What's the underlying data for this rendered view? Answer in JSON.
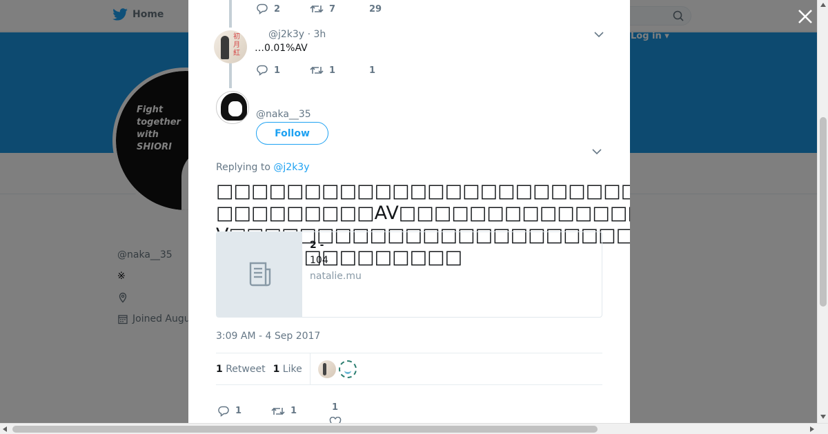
{
  "nav": {
    "home_label": "Home",
    "login_label": "Log in ▾"
  },
  "profile": {
    "avatar_text": "Fight together with SHIORI",
    "handle": "@naka__35",
    "bio_symbol": "※",
    "joined": "Joined Augu"
  },
  "thread": {
    "prev_tweet_actions": {
      "replies": "2",
      "retweets": "7",
      "likes": "29"
    },
    "parent": {
      "handle": "@j2k3y",
      "time": "· 3h",
      "text": "…0.01%AV",
      "replies": "1",
      "retweets": "1",
      "likes": "1"
    }
  },
  "main_tweet": {
    "handle": "@naka__35",
    "follow_label": "Follow",
    "replying_prefix": "Replying to",
    "replying_to": "@j2k3y",
    "text": "□□□□□□□□□□□□□□□□□□□□□□□□□□□□□□□□□□□□□□□□□□□□AV□□□□□□□□□□□□□□□□□□□□□□□□AV□□□□□□□□□□□□□□□□□□□□□□□□□□□□□□□□□□□□□□□□□□□□□□□□",
    "card": {
      "title": "2 -",
      "description": "104",
      "domain": "natalie.mu"
    },
    "timestamp": "3:09 AM - 4 Sep 2017",
    "retweet_count": "1",
    "retweet_label": "Retweet",
    "like_count": "1",
    "like_label": "Like",
    "actions": {
      "replies": "1",
      "retweets": "1",
      "likes": "1"
    }
  },
  "colors": {
    "accent": "#1da1f2",
    "banner": "#1b95e0",
    "muted": "#657786"
  }
}
